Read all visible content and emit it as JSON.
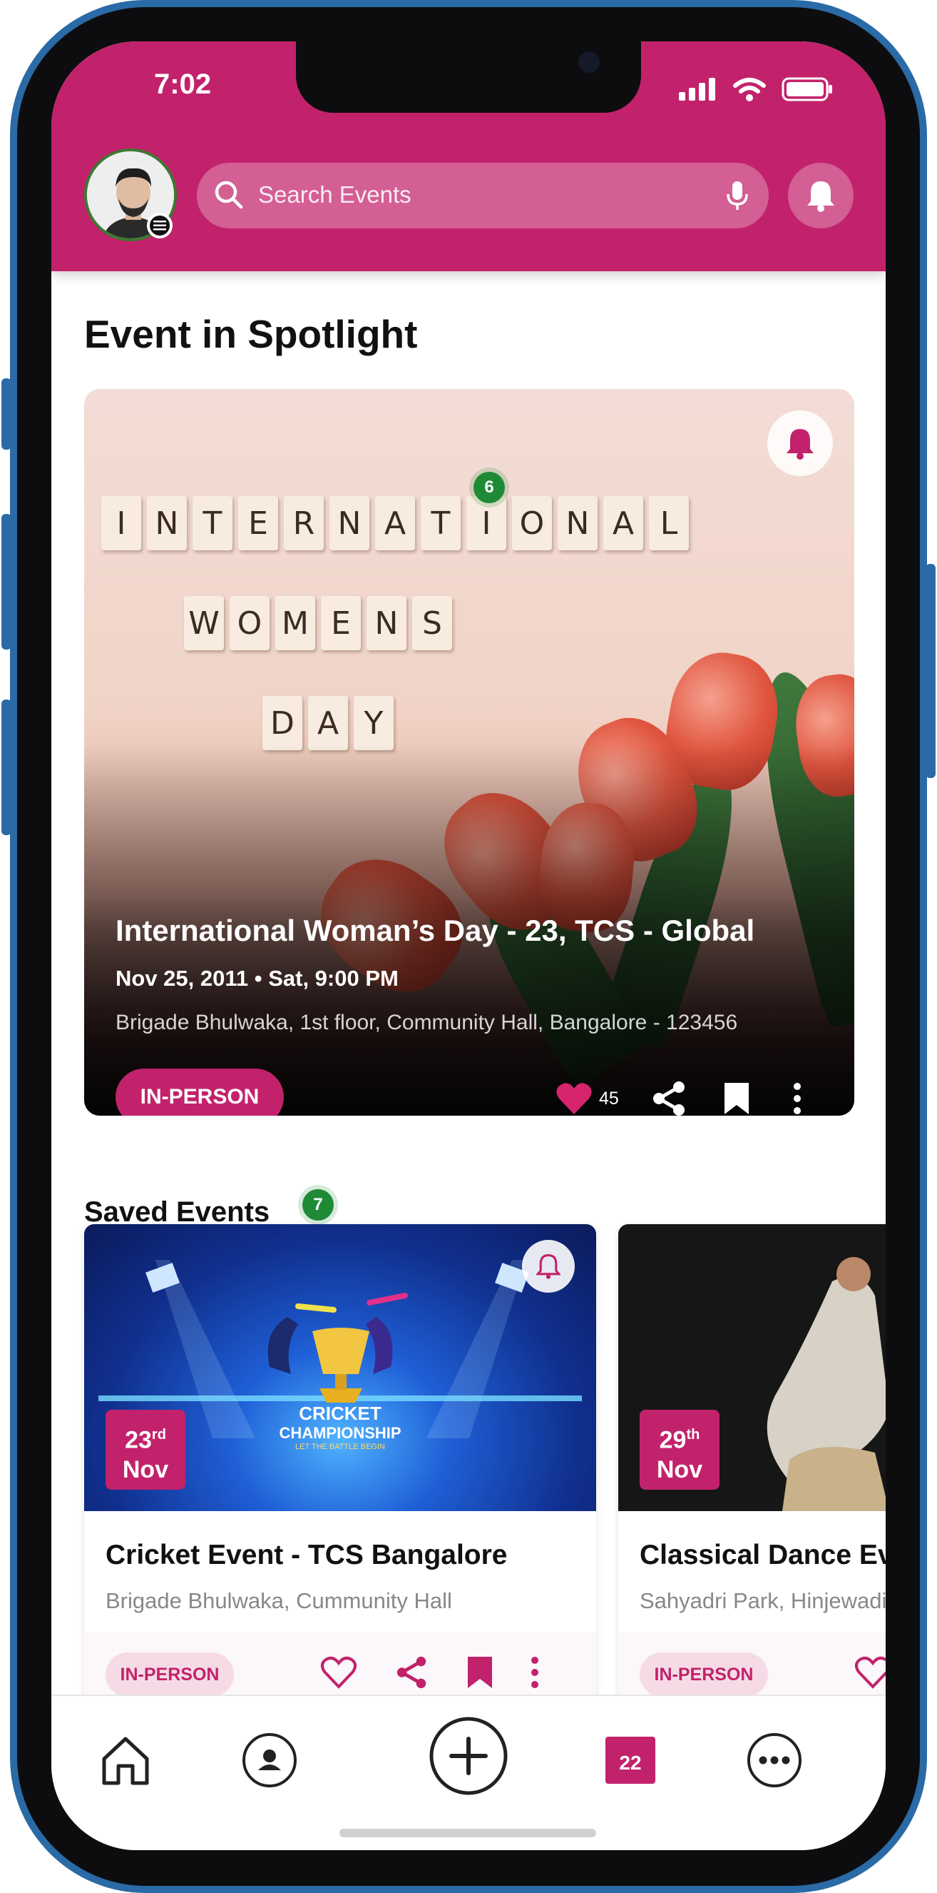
{
  "status_bar": {
    "time": "7:02"
  },
  "header": {
    "search_placeholder": "Search Events"
  },
  "spotlight": {
    "section_title": "Event in Spotlight",
    "image_tiles": [
      [
        "I",
        "N",
        "T",
        "E",
        "R",
        "N",
        "A",
        "T",
        "I",
        "O",
        "N",
        "A",
        "L"
      ],
      [
        "W",
        "O",
        "M",
        "E",
        "N",
        "S"
      ],
      [
        "D",
        "A",
        "Y"
      ]
    ],
    "badge_count": "6",
    "title": "International Woman’s Day - 23, TCS - Global",
    "date": "Nov 25, 2011 • Sat, 9:00 PM",
    "location": "Brigade Bhulwaka, 1st floor, Community Hall, Bangalore - 123456",
    "mode": "IN-PERSON",
    "likes": "45"
  },
  "saved": {
    "section_title": "Saved Events",
    "badge_count": "7",
    "events": [
      {
        "day": "23",
        "suffix": "rd",
        "month": "Nov",
        "title": "Cricket Event - TCS Bangalore",
        "location": "Brigade Bhulwaka, Cummunity Hall",
        "mode": "IN-PERSON",
        "image_text_1": "CRICKET",
        "image_text_2": "CHAMPIONSHIP",
        "image_text_3": "LET THE BATTLE BEGIN"
      },
      {
        "day": "29",
        "suffix": "th",
        "month": "Nov",
        "title": "Classical Dance Ev",
        "location": "Sahyadri Park, Hinjewadi",
        "mode": "IN-PERSON"
      }
    ]
  },
  "bottom_nav": {
    "calendar_day": "22"
  },
  "colors": {
    "brand": "#c2226b",
    "badge_green": "#1f8a36"
  }
}
